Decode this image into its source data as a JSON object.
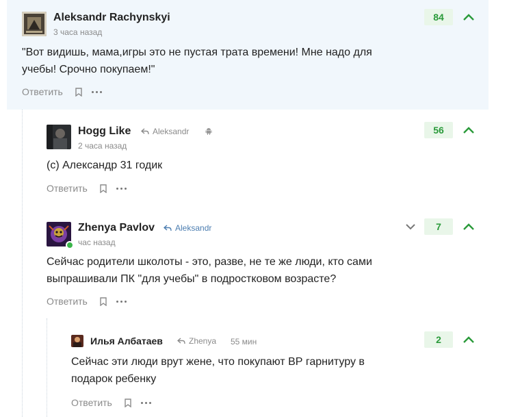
{
  "comments": [
    {
      "author": "Aleksandr Rachynskyi",
      "time": "3 часа назад",
      "text": "\"Вот видишь, мама,игры это не пустая трата времени! Мне надо для учебы! Срочно покупаем!\"",
      "score": "84",
      "reply_label": "Ответить"
    },
    {
      "author": "Hogg Like",
      "reply_to": "Aleksandr",
      "time": "2 часа назад",
      "text": "(c) Александр 31 годик",
      "score": "56",
      "reply_label": "Ответить",
      "device_icon": "android-icon"
    },
    {
      "author": "Zhenya Pavlov",
      "reply_to": "Aleksandr",
      "time": "час назад",
      "text": "Сейчас родители школоты - это, разве, не те же люди, кто сами выпрашивали ПК \"для учебы\" в подростковом возрасте?",
      "score": "7",
      "reply_label": "Ответить",
      "online": true
    },
    {
      "author": "Илья Албатаев",
      "reply_to": "Zhenya",
      "time": "55 мин",
      "text": "Сейчас эти люди врут жене, что покупают ВР гарнитуру в подарок ребенку",
      "score": "2",
      "reply_label": "Ответить"
    }
  ],
  "colors": {
    "score_text": "#2a9a3a",
    "score_bg": "#e9f6e9",
    "upvote": "#2a9a3a",
    "highlight_bg": "#f1f7fc",
    "reply_to_highlight": "#4b7db0"
  }
}
